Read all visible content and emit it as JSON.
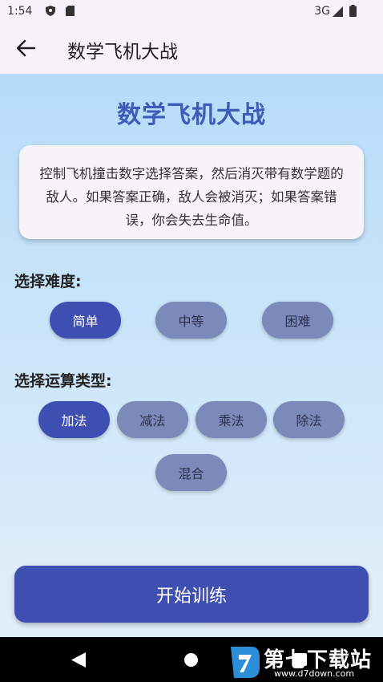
{
  "status_bar": {
    "time": "1:54",
    "network": "3G",
    "icons": [
      "shield-icon",
      "sdcard-icon",
      "signal-icon",
      "battery-icon"
    ]
  },
  "app_bar": {
    "title": "数学飞机大战",
    "back_icon": "arrow-left-icon"
  },
  "main": {
    "game_title": "数学飞机大战",
    "description": "控制飞机撞击数字选择答案，然后消灭带有数学题的敌人。如果答案正确，敌人会被消灭；如果答案错误，你会失去生命值。",
    "difficulty": {
      "label": "选择难度:",
      "options": [
        "简单",
        "中等",
        "困难"
      ],
      "selected": "简单"
    },
    "operation": {
      "label": "选择运算类型:",
      "options": [
        "加法",
        "减法",
        "乘法",
        "除法",
        "混合"
      ],
      "selected": "加法"
    },
    "start_button": "开始训练"
  },
  "nav_bar": {
    "icons": [
      "back-triangle-icon",
      "home-circle-icon",
      "recents-square-icon"
    ]
  },
  "watermark": {
    "text": "第七下载站",
    "url": "www.d7down.com"
  },
  "colors": {
    "accent": "#3f4fb1",
    "chip_unselected": "#7b8ab8",
    "title": "#3d5bb8",
    "background_top": "#b6dcf8"
  }
}
